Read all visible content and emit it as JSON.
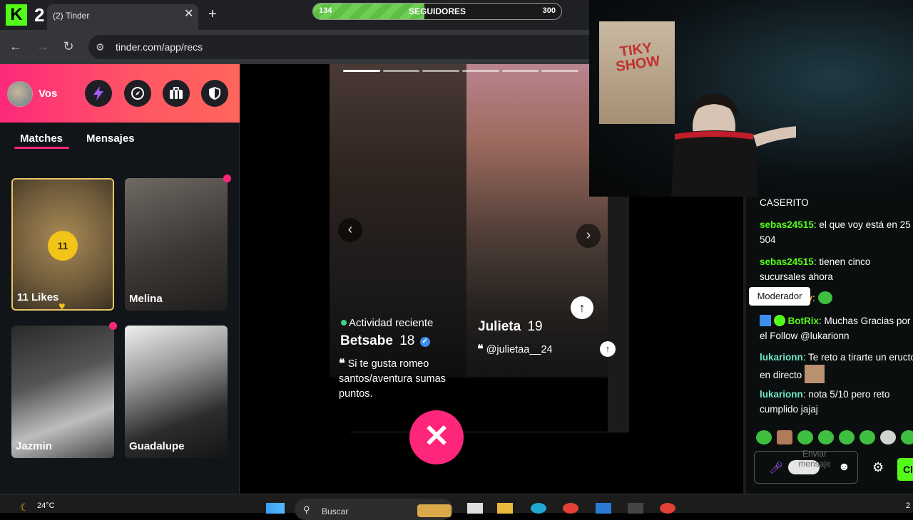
{
  "browser": {
    "tab_count_logo": "K",
    "tab_count": "2",
    "tab_title": "(2) Tinder",
    "tab_close": "✕",
    "new_tab": "+",
    "url": "tinder.com/app/recs"
  },
  "overlay": {
    "followers_current": "134",
    "followers_label": "SEGUIDORES",
    "followers_goal": "300",
    "followers_progress": 0.447
  },
  "sidebar": {
    "user_name": "Vos",
    "tabs": [
      {
        "label": "Matches",
        "active": true
      },
      {
        "label": "Mensajes",
        "active": false
      }
    ],
    "matches": [
      {
        "name": "11 Likes",
        "badge": "11"
      },
      {
        "name": "Melina",
        "new": true
      },
      {
        "name": "Jazmin",
        "new": true
      },
      {
        "name": "Guadalupe",
        "new": false
      }
    ]
  },
  "recs": {
    "current": {
      "status": "Actividad reciente",
      "name": "Betsabe",
      "age": "18",
      "bio": "Si te gusta romeo santos/aventura sumas puntos."
    },
    "next": {
      "name": "Julieta",
      "age": "19",
      "handle": "@julietaa__24"
    },
    "nope_icon": "✕"
  },
  "chat": {
    "messages": [
      {
        "user": "",
        "text": "CASERITO"
      },
      {
        "user": "sebas24515",
        "text": "el que voy está en 25 504"
      },
      {
        "user": "sebas24515",
        "text": "tienen cinco sucursales ahora"
      },
      {
        "user": "sy",
        "text": ""
      },
      {
        "user": "BotRix",
        "text": "Muchas Gracias por el Follow @lukarionn"
      },
      {
        "user": "lukarionn",
        "text": "Te reto a tirarte un eructo en directo"
      },
      {
        "user": "lukarionn",
        "text": "nota 5/10 pero reto cumplido jajaj"
      }
    ],
    "tooltip": "Moderador",
    "input_placeholder": "Enviar mensaje",
    "send_label": "Cl"
  },
  "taskbar": {
    "weather": "24°C",
    "search_placeholder": "Buscar",
    "clock": "2"
  },
  "webcam": {
    "poster_text": "TIKY SHOW"
  },
  "colors": {
    "tinder_pink": "#fd267a",
    "kick_green": "#53fc18"
  }
}
